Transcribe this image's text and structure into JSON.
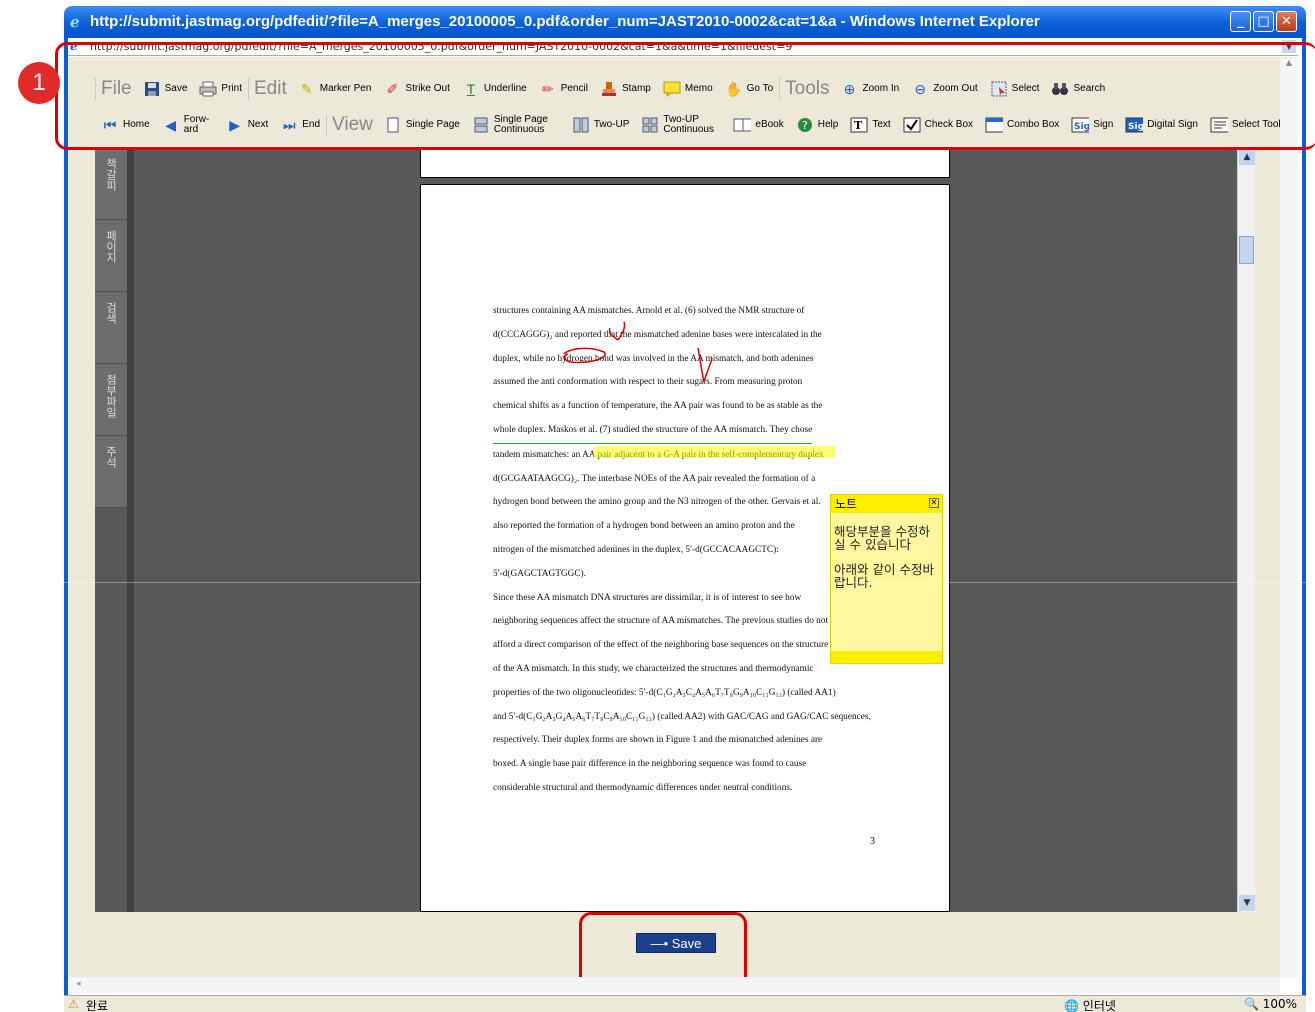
{
  "window": {
    "title": "http://submit.jastmag.org/pdfedit/?file=A_merges_20100005_0.pdf&order_num=JAST2010-0002&cat=1&a - Windows Internet Explorer",
    "url": "http://submit.jastmag.org/pdfedit/?file=A_merges_20100005_0.pdf&order_num=JAST2010-0002&cat=1&a&time=1&filedest=9"
  },
  "annotation": {
    "marker": "1"
  },
  "toolbar_row1": {
    "file_group": "File",
    "save": "Save",
    "print": "Print",
    "edit_group": "Edit",
    "marker_pen": "Marker Pen",
    "strike_out": "Strike Out",
    "underline": "Underline",
    "pencil": "Pencil",
    "stamp": "Stamp",
    "memo": "Memo",
    "goto": "Go To",
    "tools_group": "Tools",
    "zoom_in": "Zoom In",
    "zoom_out": "Zoom Out",
    "select": "Select",
    "search": "Search"
  },
  "toolbar_row2": {
    "home": "Home",
    "forward": "Forw-ard",
    "next": "Next",
    "end": "End",
    "view_group": "View",
    "single_page": "Single Page",
    "single_page_continuous": "Single Page Continuous",
    "two_up": "Two-UP",
    "two_up_continuous": "Two-UP Continuous",
    "ebook": "eBook",
    "help": "Help",
    "text": "Text",
    "check_box": "Check Box",
    "combo_box": "Combo Box",
    "sign": "Sign",
    "digital_sign": "Digital Sign",
    "select_tool": "Select Tool"
  },
  "sidetabs": [
    "책갈피",
    "페이지",
    "검색",
    "첨부파일",
    "주석"
  ],
  "document": {
    "lines": [
      "structures containing AA mismatches. Arnold et al. (6) solved the NMR structure of",
      "d(CCCAGGG)₂ and reported that the mismatched adenine bases were intercalated in the",
      "duplex, while no hydrogen bond was involved in the AA mismatch, and both adenines",
      "assumed the anti conformation with respect to their sugars. From measuring proton",
      "chemical shifts as a function of temperature, the AA pair was found to be as stable as the",
      "whole duplex. Maskos et al. (7) studied the structure of the AA mismatch. They chose",
      "tandem mismatches: an AA pair adjacent to a G-A pair in the self-complementary duplex",
      "d(GCGAATAAGCG)₂. The interbase NOEs of the AA pair revealed the formation of a",
      "hydrogen bond between the amino group and the N3 nitrogen of the other. Gervais et al.",
      "also reported the formation of a hydrogen bond between an amino proton and the",
      "nitrogen of the mismatched adenines in the duplex, 5′-d(GCCACAAGCTC):",
      "5′-d(GAGCTAGTGGC).",
      "        Since these AA mismatch DNA structures are dissimilar, it is of interest to see how",
      "neighboring sequences affect the structure of AA mismatches. The previous studies do not",
      "afford a direct comparison of the effect of the neighboring base sequences on the structure",
      "of the AA mismatch. In this study, we characterized the structures and thermodynamic",
      "properties of the two oligonucleotides: 5′-d(C₁G₂A₃C₄A₅A₆T₇T₈G₉A₁₀C₁₁G₁₂) (called AA1)",
      "and 5′-d(C₁G₂A₃G₄A₅A₆T₇T₈C₉A₁₀C₁₁G₁₂) (called AA2) with GAC/CAG and GAG/CAC sequences,",
      "respectively. Their duplex forms are shown in Figure 1 and the mismatched adenines are",
      "boxed. A single base pair difference in the neighboring sequence was found to cause",
      "considerable structural and thermodynamic differences under neutral conditions."
    ],
    "highlight": "AA pair adjacent to a G-A pair in the self-complementary",
    "page_number": "3"
  },
  "note": {
    "title": "노트",
    "body1": "해당부분을 수정하실 수 있습니다",
    "body2": "아래와 같이 수정바랍니다."
  },
  "save_button": "Save",
  "status": {
    "done": "완료",
    "zone": "인터넷",
    "zoom": "100%"
  },
  "colors": {
    "titlebar": "#0a5fd8",
    "annotation_red": "#dd0000",
    "note_yellow": "#ffee00",
    "save_button": "#1b3f8b"
  }
}
